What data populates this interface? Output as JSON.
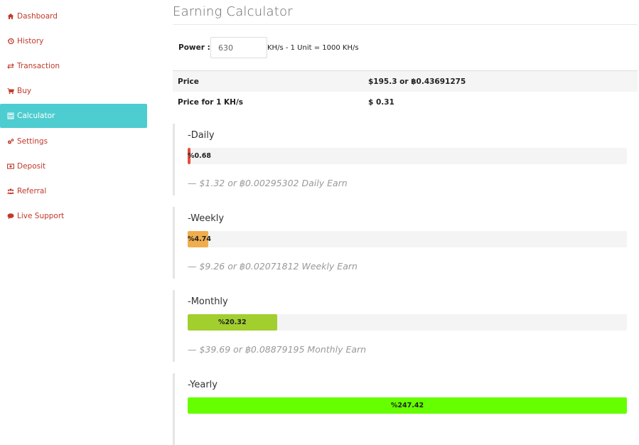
{
  "sidebar": {
    "items": [
      {
        "label": "Dashboard",
        "icon": "home-icon",
        "active": false
      },
      {
        "label": "History",
        "icon": "history-icon",
        "active": false
      },
      {
        "label": "Transaction",
        "icon": "exchange-icon",
        "active": false
      },
      {
        "label": "Buy",
        "icon": "cart-icon",
        "active": false
      },
      {
        "label": "Calculator",
        "icon": "calculator-icon",
        "active": true
      },
      {
        "label": "Settings",
        "icon": "gears-icon",
        "active": false
      },
      {
        "label": "Deposit",
        "icon": "money-icon",
        "active": false
      },
      {
        "label": "Referral",
        "icon": "users-icon",
        "active": false
      },
      {
        "label": "Live Support",
        "icon": "chat-icon",
        "active": false
      }
    ]
  },
  "page": {
    "title": "Earning Calculator"
  },
  "power": {
    "label": "Power :",
    "value": "630",
    "unit_note": "KH/s - 1 Unit = 1000 KH/s"
  },
  "prices": [
    {
      "label": "Price",
      "value": "$195.3 or ฿0.43691275"
    },
    {
      "label": "Price for 1 KH/s",
      "value": "$ 0.31"
    }
  ],
  "earnings": [
    {
      "title": "-Daily",
      "percent_label": "%0.68",
      "percent": 0.68,
      "color": "#e74c3c",
      "footer": "— $1.32 or ฿0.00295302 Daily Earn"
    },
    {
      "title": "-Weekly",
      "percent_label": "%4.74",
      "percent": 4.74,
      "color": "#f0ad4e",
      "footer": "— $9.26 or ฿0.02071812 Weekly Earn"
    },
    {
      "title": "-Monthly",
      "percent_label": "%20.32",
      "percent": 20.32,
      "color": "#a2cf2e",
      "footer": "— $39.69 or ฿0.08879195 Monthly Earn"
    },
    {
      "title": "-Yearly",
      "percent_label": "%247.42",
      "percent": 247.42,
      "color": "#66ff00",
      "footer": ""
    }
  ],
  "colors": {
    "accent": "#4ecdd0",
    "sidebar_text": "#c0392b"
  }
}
